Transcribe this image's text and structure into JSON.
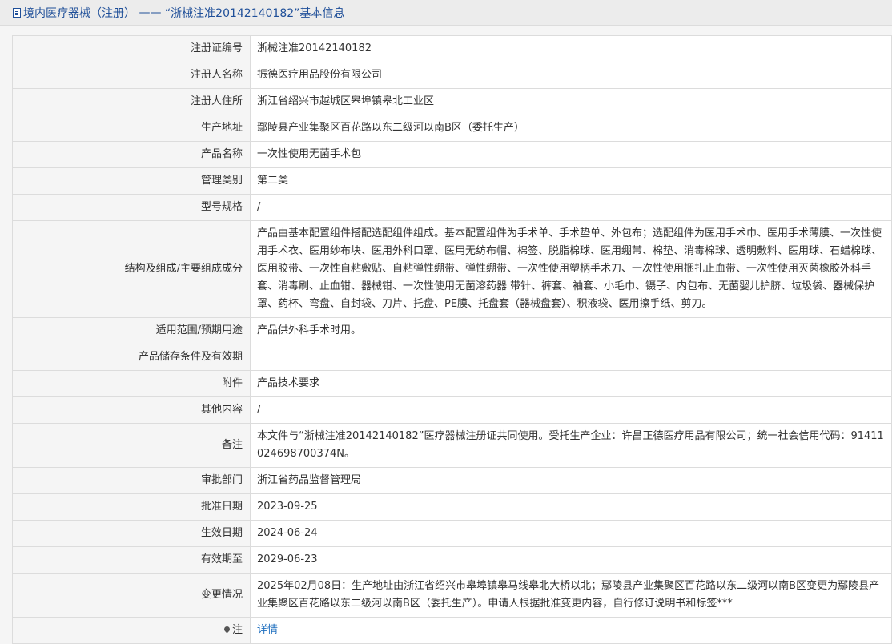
{
  "header": {
    "title_part1": "境内医疗器械（注册）",
    "separator": " —— ",
    "title_part2": "“浙械注准20142140182”基本信息"
  },
  "rows": [
    {
      "label": "注册证编号",
      "value": "浙械注准20142140182"
    },
    {
      "label": "注册人名称",
      "value": "振德医疗用品股份有限公司"
    },
    {
      "label": "注册人住所",
      "value": "浙江省绍兴市越城区皋埠镇皋北工业区"
    },
    {
      "label": "生产地址",
      "value": "鄢陵县产业集聚区百花路以东二级河以南B区（委托生产）"
    },
    {
      "label": "产品名称",
      "value": "一次性使用无菌手术包"
    },
    {
      "label": "管理类别",
      "value": "第二类"
    },
    {
      "label": "型号规格",
      "value": "/"
    },
    {
      "label": "结构及组成/主要组成成分",
      "value": "产品由基本配置组件搭配选配组件组成。基本配置组件为手术单、手术垫单、外包布；选配组件为医用手术巾、医用手术薄膜、一次性使用手术衣、医用纱布块、医用外科口罩、医用无纺布帽、棉签、脱脂棉球、医用绷带、棉垫、消毒棉球、透明敷料、医用球、石蜡棉球、医用胶带、一次性自粘敷贴、自粘弹性绷带、弹性绷带、一次性使用塑柄手术刀、一次性使用捆扎止血带、一次性使用灭菌橡胶外科手套、消毒刷、止血钳、器械钳、一次性使用无菌溶药器 带针、裤套、袖套、小毛巾、镊子、内包布、无菌婴儿护脐、垃圾袋、器械保护罩、药杯、弯盘、自封袋、刀片、托盘、PE膜、托盘套（器械盘套）、积液袋、医用擦手纸、剪刀。"
    },
    {
      "label": "适用范围/预期用途",
      "value": "产品供外科手术时用。"
    },
    {
      "label": "产品储存条件及有效期",
      "value": ""
    },
    {
      "label": "附件",
      "value": "产品技术要求"
    },
    {
      "label": "其他内容",
      "value": "/"
    },
    {
      "label": "备注",
      "value": "本文件与“浙械注准20142140182”医疗器械注册证共同使用。受托生产企业：许昌正德医疗用品有限公司；统一社会信用代码：91411024698700374N。"
    },
    {
      "label": "审批部门",
      "value": "浙江省药品监督管理局"
    },
    {
      "label": "批准日期",
      "value": "2023-09-25"
    },
    {
      "label": "生效日期",
      "value": "2024-06-24"
    },
    {
      "label": "有效期至",
      "value": "2029-06-23"
    },
    {
      "label": "变更情况",
      "value": "2025年02月08日：生产地址由浙江省绍兴市皋埠镇皋马线皋北大桥以北；鄢陵县产业集聚区百花路以东二级河以南B区变更为鄢陵县产业集聚区百花路以东二级河以南B区（委托生产）。申请人根据批准变更内容，自行修订说明书和标签***"
    }
  ],
  "note_row": {
    "label": "注",
    "link_text": "详情",
    "icon": "pin-icon"
  },
  "colors": {
    "header_text": "#1f4f99",
    "link": "#1f6fbf",
    "label_bg": "#f5f5f5",
    "border": "#dcdcdc"
  }
}
